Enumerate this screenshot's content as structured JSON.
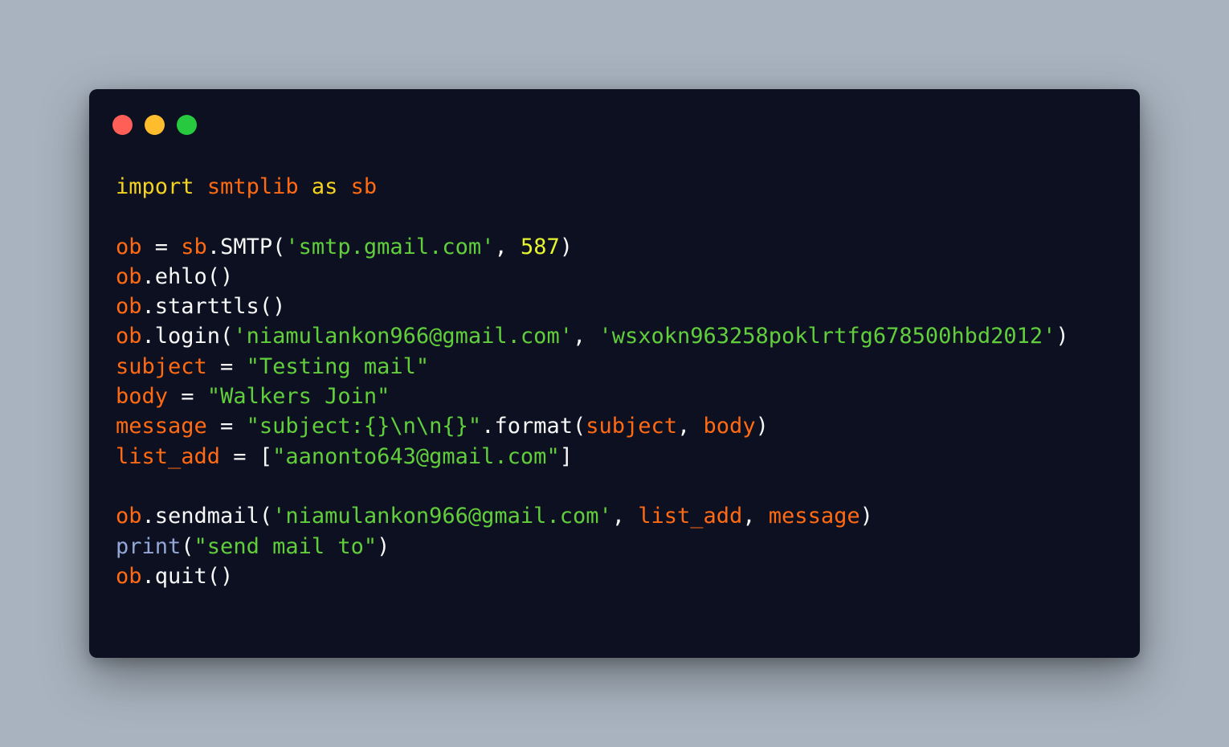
{
  "window": {
    "traffic_lights": [
      {
        "name": "close-button",
        "color": "#ff5f56"
      },
      {
        "name": "minimize-button",
        "color": "#ffbd2e"
      },
      {
        "name": "maximize-button",
        "color": "#27c93f"
      }
    ]
  },
  "colors": {
    "kw": "#f5d21f",
    "var": "#ff6a13",
    "str": "#61ce3c",
    "num": "#e6f52f",
    "fn": "#93a8d6",
    "plain": "#f8f8f8"
  },
  "code_lines": [
    [
      {
        "t": "import",
        "c": "kw"
      },
      {
        "t": " ",
        "c": "plain"
      },
      {
        "t": "smtplib",
        "c": "var"
      },
      {
        "t": " ",
        "c": "plain"
      },
      {
        "t": "as",
        "c": "kw"
      },
      {
        "t": " ",
        "c": "plain"
      },
      {
        "t": "sb",
        "c": "var"
      }
    ],
    [],
    [
      {
        "t": "ob",
        "c": "var"
      },
      {
        "t": " = ",
        "c": "plain"
      },
      {
        "t": "sb",
        "c": "var"
      },
      {
        "t": ".SMTP(",
        "c": "plain"
      },
      {
        "t": "'smtp.gmail.com'",
        "c": "str"
      },
      {
        "t": ", ",
        "c": "plain"
      },
      {
        "t": "587",
        "c": "num"
      },
      {
        "t": ")",
        "c": "plain"
      }
    ],
    [
      {
        "t": "ob",
        "c": "var"
      },
      {
        "t": ".ehlo()",
        "c": "plain"
      }
    ],
    [
      {
        "t": "ob",
        "c": "var"
      },
      {
        "t": ".starttls()",
        "c": "plain"
      }
    ],
    [
      {
        "t": "ob",
        "c": "var"
      },
      {
        "t": ".login(",
        "c": "plain"
      },
      {
        "t": "'niamulankon966@gmail.com'",
        "c": "str"
      },
      {
        "t": ", ",
        "c": "plain"
      },
      {
        "t": "'wsxokn963258poklrtfg678500hbd2012'",
        "c": "str"
      },
      {
        "t": ")",
        "c": "plain"
      }
    ],
    [
      {
        "t": "subject",
        "c": "var"
      },
      {
        "t": " = ",
        "c": "plain"
      },
      {
        "t": "\"Testing mail\"",
        "c": "str"
      }
    ],
    [
      {
        "t": "body",
        "c": "var"
      },
      {
        "t": " = ",
        "c": "plain"
      },
      {
        "t": "\"Walkers Join\"",
        "c": "str"
      }
    ],
    [
      {
        "t": "message",
        "c": "var"
      },
      {
        "t": " = ",
        "c": "plain"
      },
      {
        "t": "\"subject:{}\\n\\n{}\"",
        "c": "str"
      },
      {
        "t": ".format(",
        "c": "plain"
      },
      {
        "t": "subject",
        "c": "var"
      },
      {
        "t": ", ",
        "c": "plain"
      },
      {
        "t": "body",
        "c": "var"
      },
      {
        "t": ")",
        "c": "plain"
      }
    ],
    [
      {
        "t": "list_add",
        "c": "var"
      },
      {
        "t": " = [",
        "c": "plain"
      },
      {
        "t": "\"aanonto643@gmail.com\"",
        "c": "str"
      },
      {
        "t": "]",
        "c": "plain"
      }
    ],
    [],
    [
      {
        "t": "ob",
        "c": "var"
      },
      {
        "t": ".sendmail(",
        "c": "plain"
      },
      {
        "t": "'niamulankon966@gmail.com'",
        "c": "str"
      },
      {
        "t": ", ",
        "c": "plain"
      },
      {
        "t": "list_add",
        "c": "var"
      },
      {
        "t": ", ",
        "c": "plain"
      },
      {
        "t": "message",
        "c": "var"
      },
      {
        "t": ")",
        "c": "plain"
      }
    ],
    [
      {
        "t": "print",
        "c": "fn"
      },
      {
        "t": "(",
        "c": "plain"
      },
      {
        "t": "\"send mail to\"",
        "c": "str"
      },
      {
        "t": ")",
        "c": "plain"
      }
    ],
    [
      {
        "t": "ob",
        "c": "var"
      },
      {
        "t": ".quit()",
        "c": "plain"
      }
    ]
  ]
}
